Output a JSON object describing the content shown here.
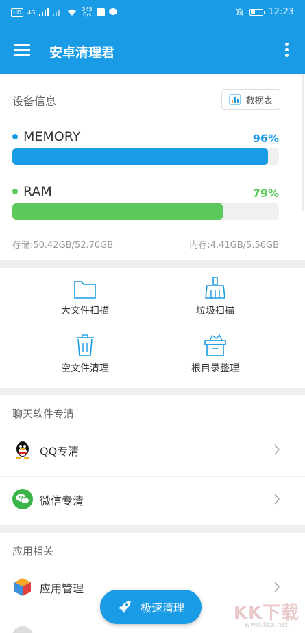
{
  "statusbar": {
    "hd": "HD",
    "net": "4G",
    "speed_top": "345",
    "speed_unit": "B/s",
    "time": "12:23"
  },
  "appbar": {
    "title": "安卓清理君"
  },
  "device": {
    "section_title": "设备信息",
    "data_table_label": "数据表",
    "memory": {
      "label": "MEMORY",
      "percent": "96%",
      "fill": 0.96,
      "color": "#1a9be6"
    },
    "ram": {
      "label": "RAM",
      "percent": "79%",
      "fill": 0.79,
      "color": "#5cc95c"
    },
    "storage": "存储:50.42GB/52.70GB",
    "memory_info": "内存:4.41GB/5.56GB"
  },
  "tools": [
    {
      "label": "大文件扫描",
      "icon": "folder-icon"
    },
    {
      "label": "垃圾扫描",
      "icon": "broom-icon"
    },
    {
      "label": "空文件清理",
      "icon": "trash-icon"
    },
    {
      "label": "根目录整理",
      "icon": "box-icon"
    }
  ],
  "chat": {
    "section_title": "聊天软件专清",
    "items": [
      {
        "label": "QQ专清",
        "icon": "qq-icon"
      },
      {
        "label": "微信专清",
        "icon": "wechat-icon"
      }
    ]
  },
  "apps": {
    "section_title": "应用相关",
    "items": [
      {
        "label": "应用管理",
        "icon": "cube-icon"
      }
    ]
  },
  "fab": {
    "label": "极速清理",
    "icon": "rocket-icon"
  },
  "watermark": {
    "big": "KK下载",
    "small": "www.kkx.net"
  },
  "colors": {
    "primary": "#1a9be6",
    "green": "#5cc95c"
  }
}
